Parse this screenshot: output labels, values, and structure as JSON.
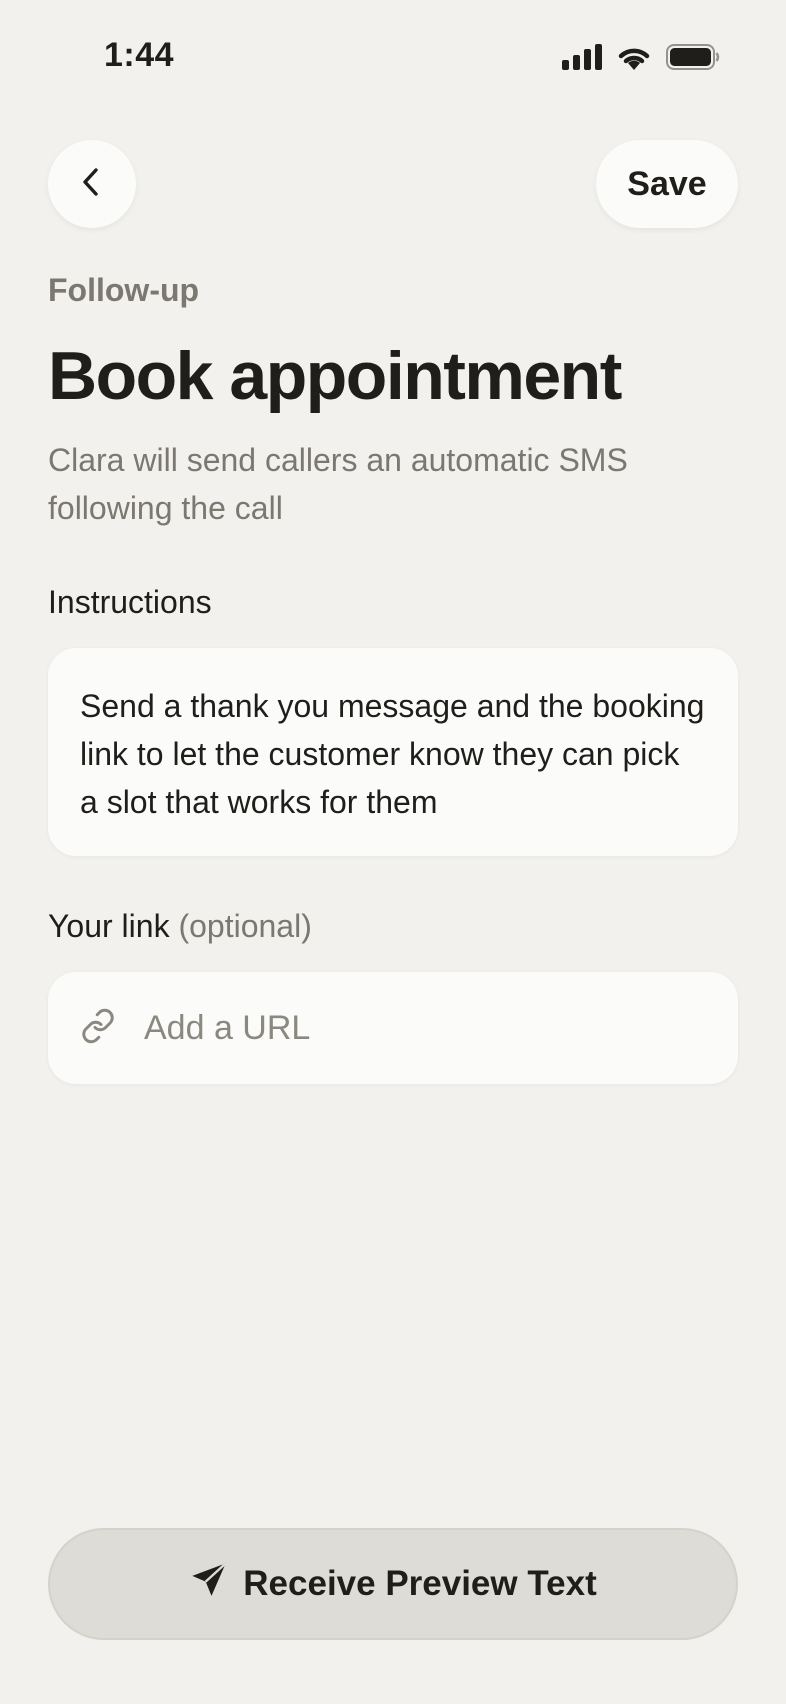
{
  "status_bar": {
    "time": "1:44",
    "icons": [
      "signal-icon",
      "wifi-icon",
      "battery-icon"
    ]
  },
  "header": {
    "back_icon": "chevron-left-icon",
    "save_label": "Save"
  },
  "main": {
    "eyebrow": "Follow-up",
    "title": "Book appointment",
    "subtitle": "Clara will send callers an automatic SMS following the call",
    "instructions": {
      "label": "Instructions",
      "text": "Send a thank you message and the booking link to let the customer know they can pick a slot that works for them"
    },
    "link": {
      "label": "Your link",
      "label_suffix": "(optional)",
      "icon": "link-icon",
      "placeholder": "Add a URL",
      "value": ""
    }
  },
  "footer": {
    "preview_icon": "paper-plane-icon",
    "preview_label": "Receive Preview Text"
  },
  "colors": {
    "background": "#f2f1ed",
    "card": "#fbfbfa",
    "text": "#1f1e1b",
    "muted": "#7a7870",
    "button": "#dedcd6"
  }
}
